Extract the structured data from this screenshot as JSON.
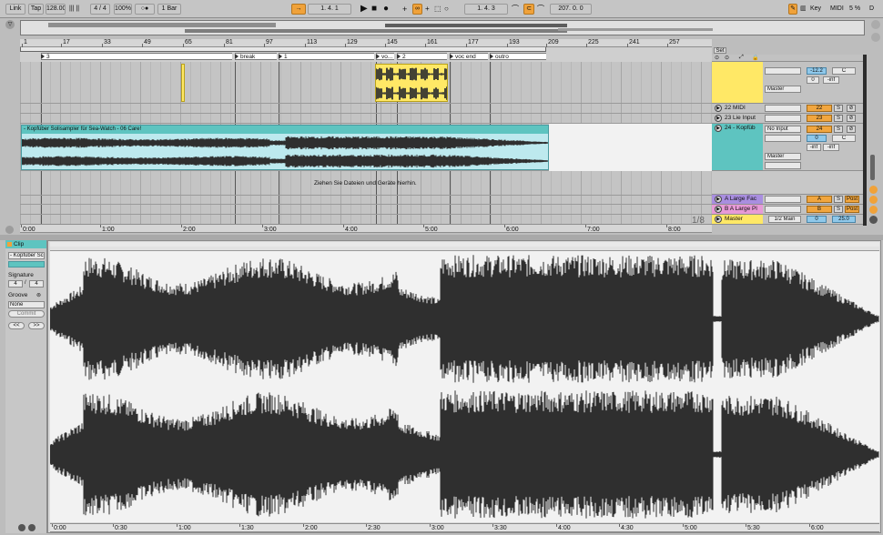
{
  "toolbar": {
    "link": "Link",
    "tap": "Tap",
    "tempo": "128.00",
    "meter_bars": "||| ||",
    "signature": "4 / 4",
    "zoom": "100%",
    "metro": "○●",
    "quant": "1 Bar",
    "position": "1. 4. 1",
    "loop_start": "1. 4. 3",
    "loop_length": "207. 0. 0",
    "key": "Key",
    "midi": "MIDI",
    "cpu": "5 %",
    "d": "D"
  },
  "arrangement": {
    "bar_ticks": [
      "1",
      "17",
      "33",
      "49",
      "65",
      "81",
      "97",
      "113",
      "129",
      "145",
      "161",
      "177",
      "193",
      "209",
      "225",
      "241",
      "257"
    ],
    "locators": [
      {
        "label": "3"
      },
      {
        "label": "break"
      },
      {
        "label": "1"
      },
      {
        "label": "vo..."
      },
      {
        "label": "2"
      },
      {
        "label": "voc end"
      },
      {
        "label": "outro"
      }
    ],
    "set_label": "Set",
    "clip_name": "- Kopfüber Solisampler für Sea-Watch - 06 Care!",
    "drop_hint": "Ziehen Sie Dateien und Geräte hierhin.",
    "time_ticks": [
      "0:00",
      "1:00",
      "2:00",
      "3:00",
      "4:00",
      "5:00",
      "6:00",
      "7:00",
      "8:00"
    ],
    "zoom_ratio": "1/8"
  },
  "tracks": [
    {
      "name": "",
      "vol": "-12.2",
      "pan": "C",
      "send1": "0",
      "send2": "-inf",
      "out": "Master"
    },
    {
      "name": "22 MIDI",
      "num": "22",
      "s": "S"
    },
    {
      "name": "23 Lie Input",
      "num": "23",
      "s": "S"
    },
    {
      "name": "24 - Kopfüb",
      "num": "24",
      "s": "S",
      "input": "No Input",
      "vol": "0",
      "pan": "C",
      "send1": "-inf",
      "send2": "-inf",
      "out": "Master"
    },
    {
      "name": "A Large Fac",
      "num": "A",
      "s": "S",
      "post": "Post"
    },
    {
      "name": "B A Large Pl",
      "num": "B",
      "s": "S",
      "post": "Post"
    },
    {
      "name": "Master",
      "out": "1/2 Main",
      "vol": "0",
      "pan": "25.0"
    }
  ],
  "clip_view": {
    "title": "Clip",
    "name": "- Kopfüber Sc",
    "signature_label": "Signature",
    "sig_num": "4",
    "sig_den": "4",
    "groove_label": "Groove",
    "groove_value": "None",
    "commit": "Commit",
    "prev": "<<",
    "next": ">>",
    "time_ticks": [
      "0:00",
      "0:30",
      "1:00",
      "1:30",
      "2:00",
      "2:30",
      "3:00",
      "3:30",
      "4:00",
      "4:30",
      "5:00",
      "5:30",
      "6:00"
    ]
  },
  "colors": {
    "clip_teal": "#5ec4c0",
    "clip_yellow": "#ffe866",
    "orange": "#f0a23a",
    "track_purple": "#a98ee0",
    "track_pink": "#e79ad7",
    "master_yellow": "#ffe866",
    "waveform": "#2f2f2f"
  }
}
